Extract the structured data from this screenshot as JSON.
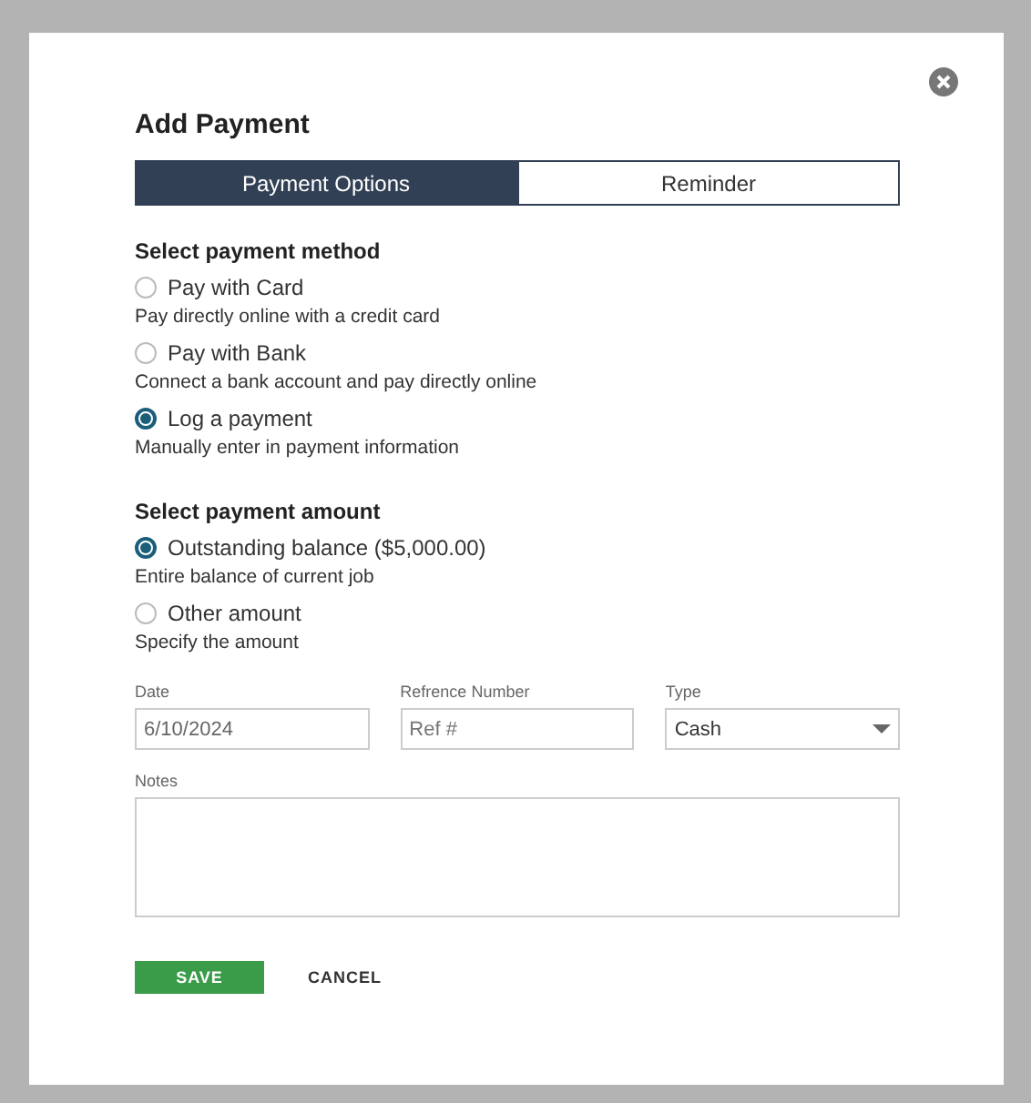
{
  "dialog": {
    "title": "Add Payment"
  },
  "tabs": [
    {
      "label": "Payment Options",
      "selected": true
    },
    {
      "label": "Reminder",
      "selected": false
    }
  ],
  "sections": [
    {
      "heading": "Select payment method",
      "options": [
        {
          "label": "Pay with Card",
          "description": "Pay directly online with a credit card",
          "selected": false
        },
        {
          "label": "Pay with Bank",
          "description": "Connect a bank account and pay directly online",
          "selected": false
        },
        {
          "label": "Log a payment",
          "description": "Manually enter in payment information",
          "selected": true
        }
      ]
    },
    {
      "heading": "Select payment amount",
      "options": [
        {
          "label": "Outstanding balance ($5,000.00)",
          "description": "Entire balance of current job",
          "selected": true
        },
        {
          "label": "Other amount",
          "description": "Specify the amount",
          "selected": false
        }
      ]
    }
  ],
  "fields": [
    {
      "label": "Date",
      "kind": "text",
      "value": "6/10/2024"
    },
    {
      "label": "Refrence Number",
      "kind": "text",
      "placeholder": "Ref #"
    },
    {
      "label": "Type",
      "kind": "select",
      "value": "Cash"
    }
  ],
  "notes": {
    "label": "Notes"
  },
  "buttons": [
    {
      "label": "SAVE",
      "kind": "primary"
    },
    {
      "label": "CANCEL",
      "kind": "text"
    }
  ]
}
